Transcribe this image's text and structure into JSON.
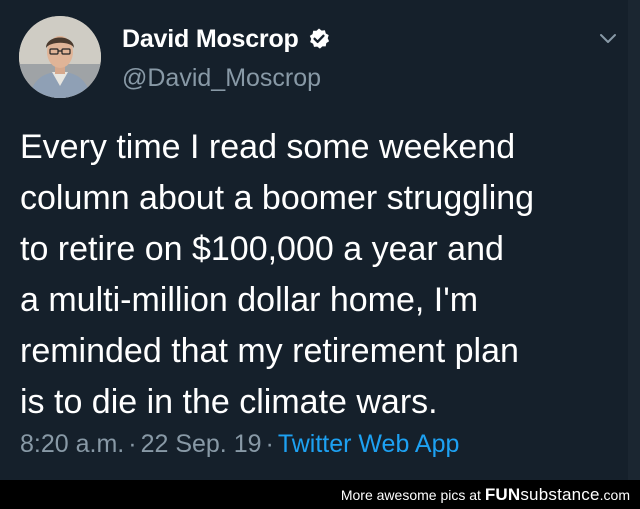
{
  "tweet": {
    "display_name": "David Moscrop",
    "handle": "@David_Moscrop",
    "text": "Every time I read some weekend\ncolumn about a boomer struggling\nto retire on $100,000 a year and\na multi-million dollar home, I'm\nreminded that my retirement plan\nis to die in the climate wars.",
    "time": "8:20 a.m.",
    "date": "22 Sep. 19",
    "separator": "·",
    "source_app": "Twitter Web App",
    "verified": true
  },
  "watermark": {
    "prefix": "More awesome pics at",
    "brand_bold": "FUN",
    "brand_rest": "substance",
    "brand_suffix": ".com"
  },
  "icons": {
    "verified": "verified-badge-icon",
    "caret": "chevron-down-icon"
  },
  "colors": {
    "background": "#15202b",
    "secondary_text": "#8899a6",
    "link": "#1da1f2",
    "footer_bg": "#000000"
  }
}
